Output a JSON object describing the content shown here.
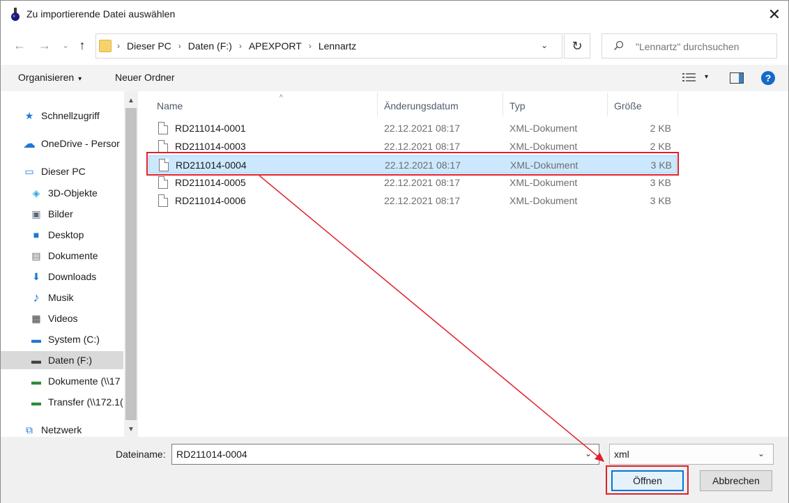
{
  "window": {
    "title": "Zu importierende Datei auswählen",
    "close_glyph": "✕"
  },
  "nav": {
    "back_glyph": "←",
    "forward_glyph": "→",
    "recent_glyph": "⌄",
    "up_glyph": "↑",
    "breadcrumb": [
      "Dieser PC",
      "Daten (F:)",
      "APEXPORT",
      "Lennartz"
    ],
    "separator_glyph": "›",
    "dropdown_glyph": "⌄",
    "refresh_glyph": "↻",
    "search_placeholder": "\"Lennartz\" durchsuchen"
  },
  "toolbar": {
    "organize_label": "Organisieren",
    "organize_caret": "▾",
    "new_folder_label": "Neuer Ordner",
    "view_caret": "▾",
    "help_glyph": "?"
  },
  "sidebar": {
    "items": [
      {
        "label": "Schnellzugriff",
        "icon": "star-icon",
        "glyph": "★",
        "color": "#1f78d1"
      },
      {
        "label": "OneDrive - Persor",
        "icon": "cloud-icon",
        "glyph": "☁",
        "color": "#1f78d1"
      },
      {
        "label": "Dieser PC",
        "icon": "computer-icon",
        "glyph": "▭",
        "color": "#1f78d1"
      },
      {
        "label": "3D-Objekte",
        "icon": "cube-icon",
        "glyph": "◈",
        "color": "#2fa7d9"
      },
      {
        "label": "Bilder",
        "icon": "pictures-icon",
        "glyph": "▣",
        "color": "#5a6a7a"
      },
      {
        "label": "Desktop",
        "icon": "desktop-icon",
        "glyph": "■",
        "color": "#1f78d1"
      },
      {
        "label": "Dokumente",
        "icon": "documents-icon",
        "glyph": "▤",
        "color": "#6a6a6a"
      },
      {
        "label": "Downloads",
        "icon": "download-icon",
        "glyph": "⬇",
        "color": "#1f78d1"
      },
      {
        "label": "Musik",
        "icon": "music-icon",
        "glyph": "♪",
        "color": "#1f78d1"
      },
      {
        "label": "Videos",
        "icon": "video-icon",
        "glyph": "▦",
        "color": "#333333"
      },
      {
        "label": "System (C:)",
        "icon": "system-drive-icon",
        "glyph": "▬",
        "color": "#1f78d1"
      },
      {
        "label": "Daten (F:)",
        "icon": "drive-icon",
        "glyph": "▬",
        "color": "#444444"
      },
      {
        "label": "Dokumente (\\\\17",
        "icon": "network-drive-icon",
        "glyph": "▬",
        "color": "#2e8b3a"
      },
      {
        "label": "Transfer (\\\\172.1(",
        "icon": "network-drive-icon",
        "glyph": "▬",
        "color": "#2e8b3a"
      },
      {
        "label": "Netzwerk",
        "icon": "network-icon",
        "glyph": "⧉",
        "color": "#1f78d1"
      }
    ],
    "scroll_up_glyph": "▲",
    "scroll_down_glyph": "▼"
  },
  "columns": {
    "name": "Name",
    "date": "Änderungsdatum",
    "type": "Typ",
    "size": "Größe",
    "sort_glyph": "^"
  },
  "files": [
    {
      "name": "RD211014-0001",
      "date": "22.12.2021 08:17",
      "type": "XML-Dokument",
      "size": "2 KB"
    },
    {
      "name": "RD211014-0003",
      "date": "22.12.2021 08:17",
      "type": "XML-Dokument",
      "size": "2 KB"
    },
    {
      "name": "RD211014-0004",
      "date": "22.12.2021 08:17",
      "type": "XML-Dokument",
      "size": "3 KB"
    },
    {
      "name": "RD211014-0005",
      "date": "22.12.2021 08:17",
      "type": "XML-Dokument",
      "size": "3 KB"
    },
    {
      "name": "RD211014-0006",
      "date": "22.12.2021 08:17",
      "type": "XML-Dokument",
      "size": "3 KB"
    }
  ],
  "footer": {
    "filename_label": "Dateiname:",
    "filename_value": "RD211014-0004",
    "filename_dd_glyph": "⌄",
    "filetype_value": "xml",
    "filetype_dd_glyph": "⌄",
    "open_label": "Öffnen",
    "cancel_label": "Abbrechen"
  },
  "colors": {
    "annotation": "#e0202a",
    "selection": "#cce8ff",
    "accent": "#0078d7"
  }
}
